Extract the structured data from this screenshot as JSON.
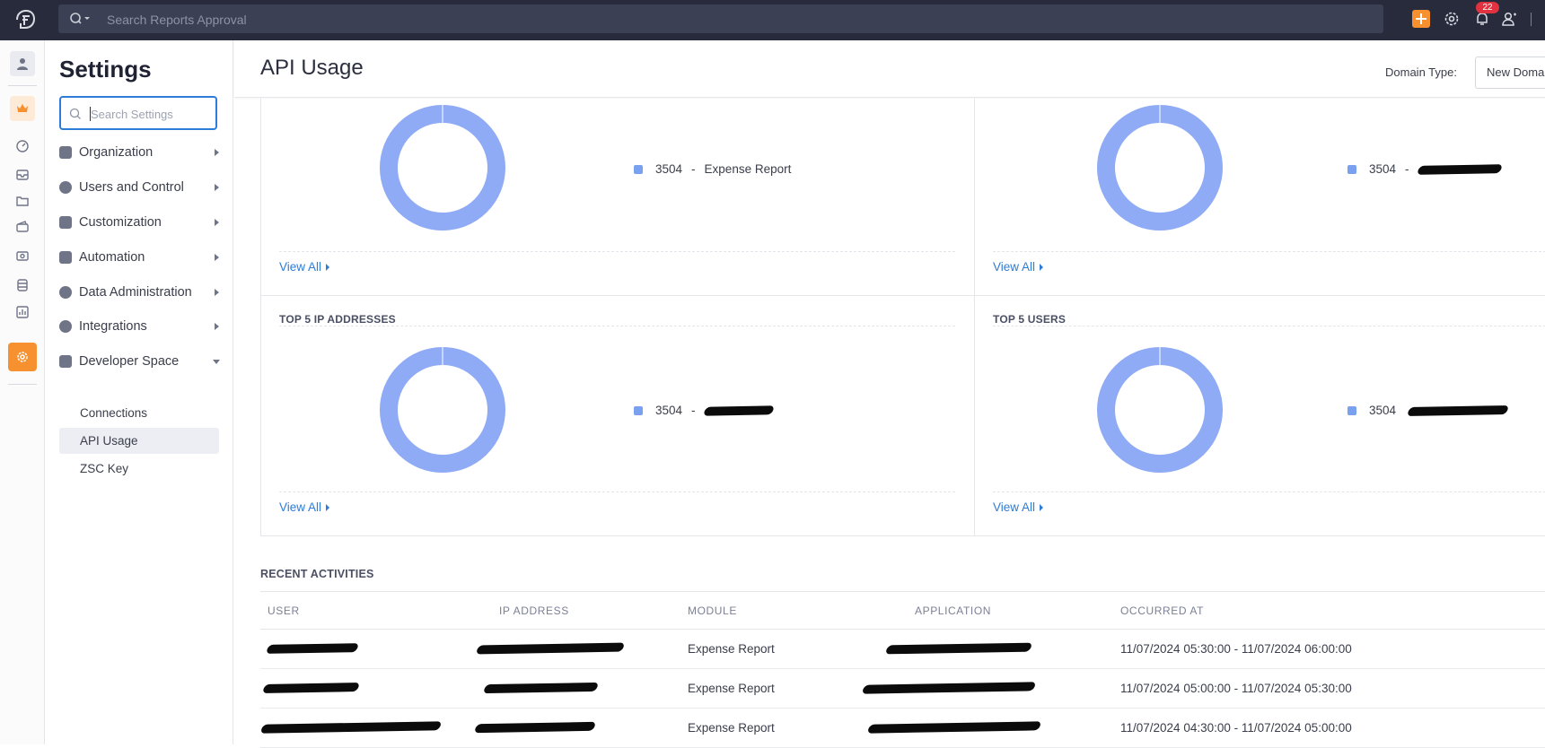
{
  "topbar": {
    "search_placeholder": "Search Reports Approval",
    "notification_count": "22"
  },
  "sidebar": {
    "title": "Settings",
    "search_placeholder": "Search Settings",
    "items": [
      {
        "label": "Organization"
      },
      {
        "label": "Users and Control"
      },
      {
        "label": "Customization"
      },
      {
        "label": "Automation"
      },
      {
        "label": "Data Administration"
      },
      {
        "label": "Integrations"
      },
      {
        "label": "Developer Space"
      }
    ],
    "subitems": [
      {
        "label": "Connections"
      },
      {
        "label": "API Usage"
      },
      {
        "label": "ZSC Key"
      }
    ]
  },
  "header": {
    "title": "API Usage",
    "domain_label": "Domain Type:",
    "domain_value": "New Domain"
  },
  "panels": [
    {
      "title": "",
      "legend_value": "3504",
      "legend_label": "Expense Report",
      "view_all": "View All"
    },
    {
      "title": "",
      "legend_value": "3504",
      "legend_label": "",
      "view_all": "View All"
    },
    {
      "title": "TOP 5 IP ADDRESSES",
      "legend_value": "3504",
      "legend_label": "",
      "view_all": "View All"
    },
    {
      "title": "TOP 5 USERS",
      "legend_value": "3504",
      "legend_label": "",
      "view_all": "View All"
    }
  ],
  "chart_data": [
    {
      "type": "pie",
      "categories": [
        "Expense Report"
      ],
      "values": [
        3504
      ]
    },
    {
      "type": "pie",
      "categories": [
        ""
      ],
      "values": [
        3504
      ]
    },
    {
      "type": "pie",
      "categories": [
        ""
      ],
      "values": [
        3504
      ]
    },
    {
      "type": "pie",
      "categories": [
        ""
      ],
      "values": [
        3504
      ]
    }
  ],
  "recent": {
    "title": "RECENT ACTIVITIES",
    "columns": [
      "USER",
      "IP ADDRESS",
      "MODULE",
      "APPLICATION",
      "OCCURRED AT"
    ],
    "rows": [
      {
        "module": "Expense Report",
        "occurred_at": "11/07/2024 05:30:00 - 11/07/2024 06:00:00"
      },
      {
        "module": "Expense Report",
        "occurred_at": "11/07/2024 05:00:00 - 11/07/2024 05:30:00"
      },
      {
        "module": "Expense Report",
        "occurred_at": "11/07/2024 04:30:00 - 11/07/2024 05:00:00"
      }
    ]
  },
  "colors": {
    "accent": "#f7912f",
    "link": "#2f7cd6",
    "donut": "#8fabf5",
    "topbar": "#272b3b"
  }
}
